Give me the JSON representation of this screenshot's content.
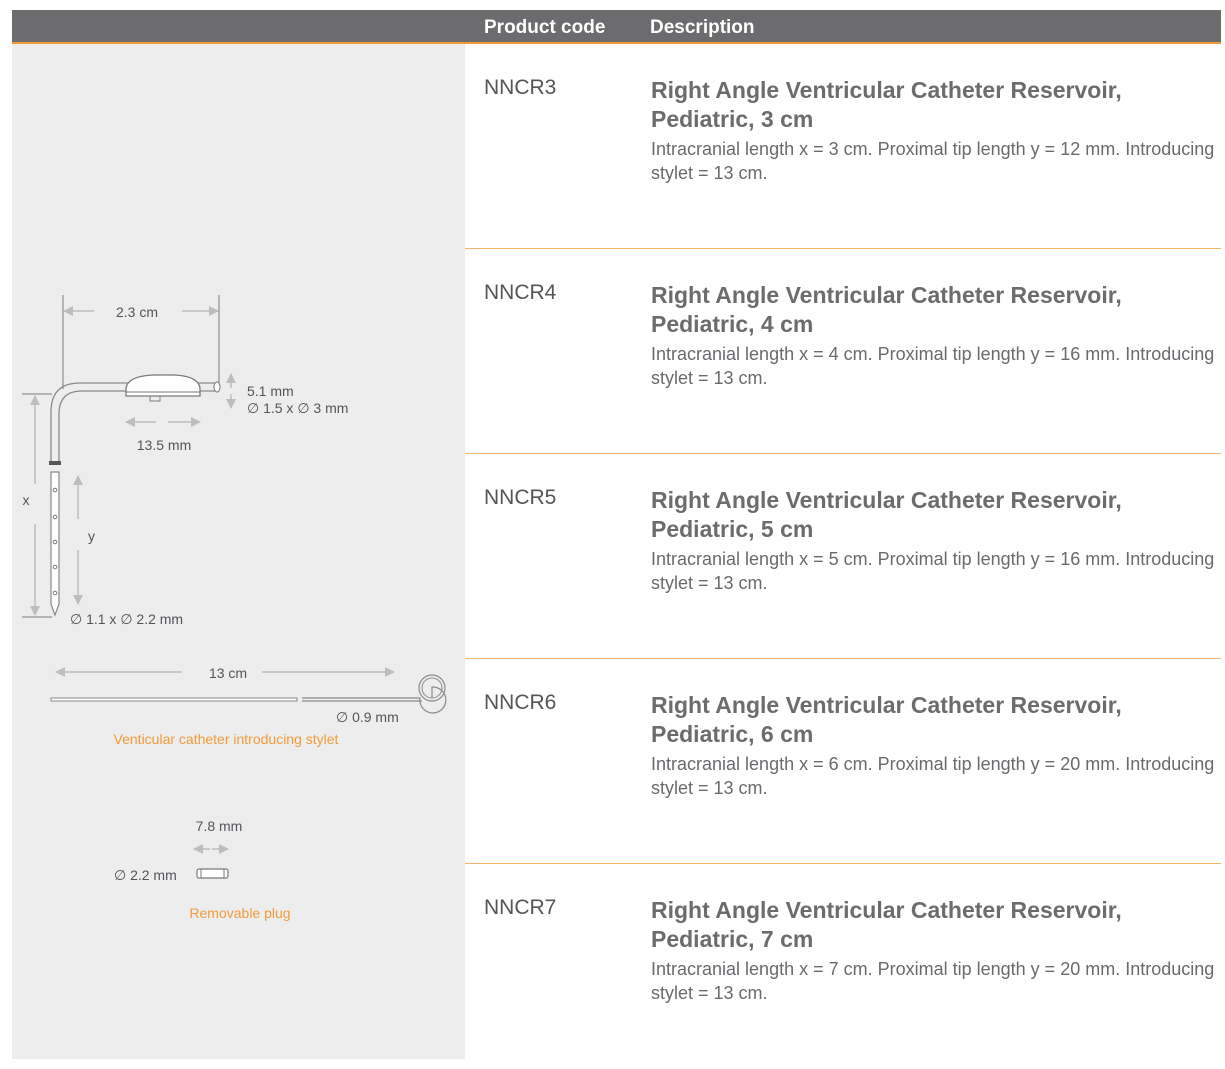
{
  "header": {
    "code_label": "Product code",
    "description_label": "Description"
  },
  "figure": {
    "dim_width": "2.3 cm",
    "dim_height": "5.1 mm",
    "dim_reservoir_diam": "∅ 1.5 x ∅ 3 mm",
    "dim_base": "13.5 mm",
    "label_x": "x",
    "label_y": "y",
    "dim_catheter_diam": "∅ 1.1 x ∅ 2.2 mm",
    "stylet_length": "13 cm",
    "stylet_diam": "∅ 0.9 mm",
    "stylet_caption": "Venticular catheter introducing stylet",
    "plug_length": "7.8 mm",
    "plug_diam": "∅ 2.2 mm",
    "plug_caption": "Removable plug"
  },
  "products": [
    {
      "code": "NNCR3",
      "title": "Right Angle Ventricular Catheter Reservoir, Pediatric, 3 cm",
      "desc": "Intracranial length x = 3 cm. Proximal tip length y = 12 mm. Introducing stylet = 13 cm."
    },
    {
      "code": "NNCR4",
      "title": "Right Angle Ventricular Catheter Reservoir, Pediatric, 4 cm",
      "desc": "Intracranial length x = 4 cm. Proximal tip length y = 16 mm. Introducing stylet = 13 cm."
    },
    {
      "code": "NNCR5",
      "title": "Right Angle Ventricular Catheter Reservoir, Pediatric, 5 cm",
      "desc": "Intracranial length x = 5 cm. Proximal tip length y = 16 mm. Introducing stylet = 13 cm."
    },
    {
      "code": "NNCR6",
      "title": "Right Angle Ventricular Catheter Reservoir, Pediatric, 6 cm",
      "desc": "Intracranial length x = 6 cm. Proximal tip length y = 20 mm. Introducing stylet = 13 cm."
    },
    {
      "code": "NNCR7",
      "title": "Right Angle Ventricular Catheter Reservoir, Pediatric, 7 cm",
      "desc": "Intracranial length x = 7 cm. Proximal tip length y = 20 mm. Introducing stylet = 13 cm."
    }
  ],
  "colors": {
    "header_bg": "#6c6b6d",
    "accent": "#f29a3a",
    "panel_bg": "#ededee",
    "title_text": "#6c6b6d",
    "body_text": "#6a696e"
  }
}
